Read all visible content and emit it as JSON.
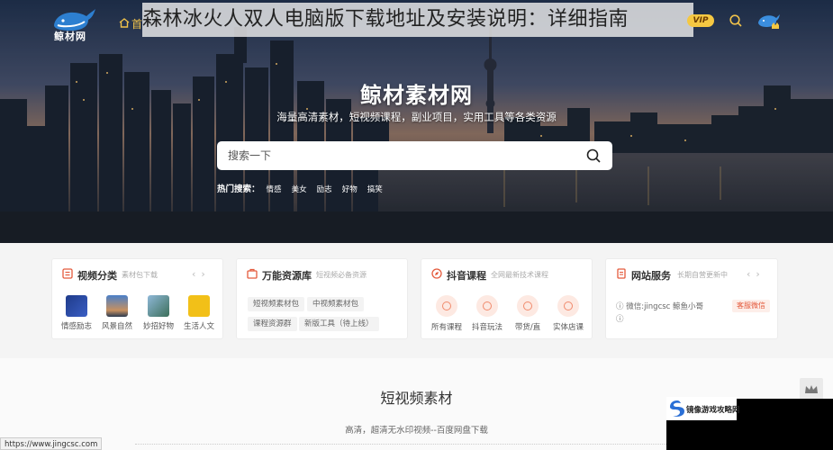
{
  "overlay_title": "森林冰火人双人电脑版下载地址及安装说明：详细指南",
  "nav": {
    "logo_text": "鲸材网",
    "home": "首",
    "vip": "VIP",
    "icons": [
      "home-icon",
      "search-icon",
      "avatar-icon"
    ]
  },
  "hero": {
    "title": "鲸材素材网",
    "subtitle": "海量高清素材，短视频课程，副业项目，实用工具等各类资源",
    "search_placeholder": "搜索一下",
    "hot_label": "热门搜索：",
    "hot_tags": [
      "情感",
      "美女",
      "励志",
      "好物",
      "搞笑"
    ]
  },
  "cards": {
    "video": {
      "title": "视频分类",
      "subtitle": "素材包下载",
      "items": [
        "情感励志",
        "风景自然",
        "妙招好物",
        "生活人文"
      ]
    },
    "resource": {
      "title": "万能资源库",
      "subtitle": "短视频必备资源",
      "tags": [
        "短视频素材包",
        "中视频素材包",
        "课程资源群",
        "新版工具（待上线）"
      ]
    },
    "douyin": {
      "title": "抖音课程",
      "subtitle": "全网最新技术课程",
      "items": [
        "所有课程",
        "抖音玩法",
        "带货/直",
        "实体店课"
      ]
    },
    "service": {
      "title": "网站服务",
      "subtitle": "长期自营更新中",
      "line1": "微信:jingcsc 鲸鱼小哥",
      "button": "客服微信"
    }
  },
  "section": {
    "title": "短视频素材",
    "subtitle": "高清，超清无水印视频--百度网盘下载"
  },
  "status_url": "https://www.jingcsc.com",
  "watermark": "镜像游戏攻略网"
}
